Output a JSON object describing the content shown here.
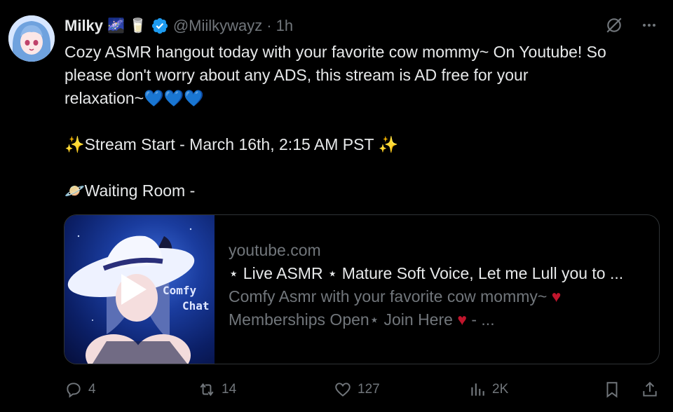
{
  "author": {
    "name": "Milky",
    "name_emojis": [
      "🌌",
      "🥛"
    ],
    "handle": "@Miilkywayz",
    "separator": "·",
    "time": "1h",
    "verified": true
  },
  "post": {
    "line1": "Cozy ASMR hangout today with your favorite cow mommy~ On Youtube! So",
    "line2": "please don't worry about any ADS, this stream is AD free for your",
    "line3": "relaxation~💙💙💙",
    "stream_start": "✨Stream Start - March 16th, 2:15 AM PST ✨",
    "waiting_room": "🪐Waiting Room -"
  },
  "card": {
    "domain": "youtube.com",
    "title": "⋆ Live ASMR ⋆ Mature Soft Voice, Let me Lull you to ...",
    "desc_line1": "Comfy Asmr with your favorite cow mommy~ ♥",
    "desc_line2": "Memberships Open⋆ Join Here ♥ - ...",
    "thumb_text1": "Comfy",
    "thumb_text2": "Chat"
  },
  "stats": {
    "replies": "4",
    "reposts": "14",
    "likes": "127",
    "views": "2K"
  },
  "colors": {
    "background": "#000000",
    "text": "#e7e9ea",
    "muted": "#71767b",
    "verified": "#1d9bf0",
    "heart": "#c0152c"
  },
  "icons": [
    "grok-icon",
    "more-icon",
    "verified-badge-icon",
    "play-icon",
    "reply-icon",
    "repost-icon",
    "like-icon",
    "views-icon",
    "bookmark-icon",
    "share-icon"
  ]
}
